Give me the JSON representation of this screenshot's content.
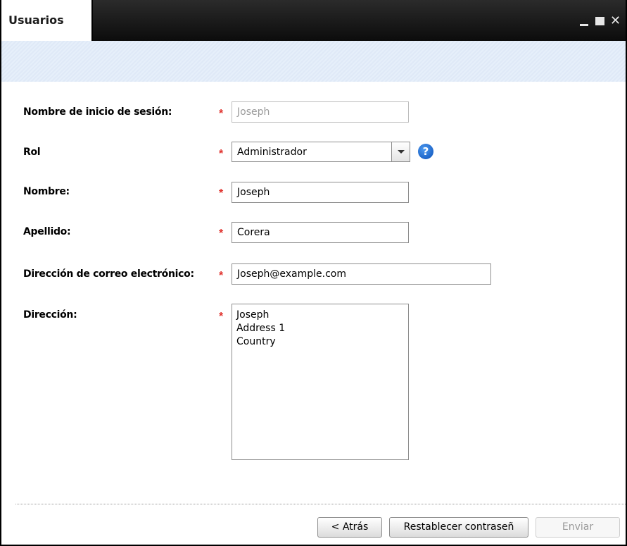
{
  "window": {
    "title": "Usuarios",
    "controls": {
      "minimize": "minimize-icon",
      "maximize": "maximize-icon",
      "close": "close-icon"
    }
  },
  "form": {
    "login": {
      "label": "Nombre de inicio de sesión:",
      "value": "Joseph",
      "required": true
    },
    "role": {
      "label": "Rol",
      "value": "Administrador",
      "required": true,
      "help_icon": "help-icon"
    },
    "first_name": {
      "label": "Nombre:",
      "value": "Joseph",
      "required": true
    },
    "last_name": {
      "label": "Apellido:",
      "value": "Corera",
      "required": true
    },
    "email": {
      "label": "Dirección de correo electrónico:",
      "value": "Joseph@example.com",
      "required": true
    },
    "address": {
      "label": "Dirección:",
      "lines": [
        "Joseph",
        "Address 1",
        "Country"
      ],
      "required": true
    },
    "required_marker": "*"
  },
  "buttons": {
    "back": "< Atrás",
    "reset_password": "Restablecer contraseñ",
    "submit": "Enviar"
  },
  "colors": {
    "required": "#e0302b",
    "titlebar": "#1a1a1a",
    "band": "#e2ecf8",
    "help": "#1a62d0"
  }
}
